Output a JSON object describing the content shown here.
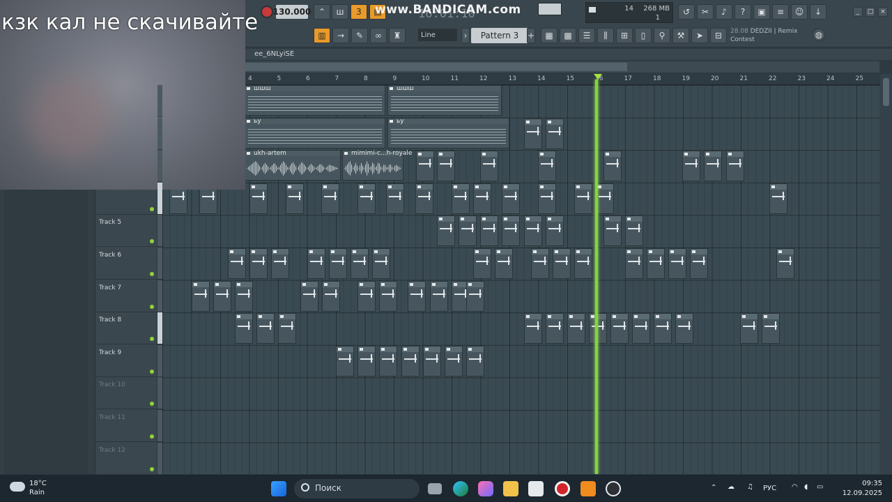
{
  "overlay": {
    "caption": "кзк кал не скачивайте"
  },
  "toolbar": {
    "tempo": "130.000",
    "time": "16:01:10",
    "watermark": "www.BANDICAM.com",
    "cpu_value": "14",
    "ram_value": "268 MB",
    "poly_value": "1",
    "snap_label": "Line",
    "pattern_label": "Pattern 3",
    "news_date": "28.08",
    "news_text": "DEDZII | Remix Contest"
  },
  "playlist": {
    "title": "ee_6NLyiSE",
    "ruler_ticks": [
      "4",
      "5",
      "6",
      "7",
      "8",
      "9",
      "10",
      "11",
      "12",
      "13",
      "14",
      "15",
      "16",
      "17",
      "18",
      "19",
      "20",
      "21",
      "22",
      "23",
      "24",
      "25"
    ],
    "tracks": [
      {
        "name": "",
        "dim": false
      },
      {
        "name": "",
        "dim": false
      },
      {
        "name": "",
        "dim": false
      },
      {
        "name": "",
        "dim": false
      },
      {
        "name": "Track 5",
        "dim": false
      },
      {
        "name": "Track 6",
        "dim": false
      },
      {
        "name": "Track 7",
        "dim": false
      },
      {
        "name": "Track 8",
        "dim": false
      },
      {
        "name": "Track 9",
        "dim": false
      },
      {
        "name": "Track 10",
        "dim": true
      },
      {
        "name": "Track 11",
        "dim": true
      },
      {
        "name": "Track 12",
        "dim": true
      }
    ],
    "named_clips": {
      "c1": "шшш",
      "c2": "шшш",
      "c3": "ьу",
      "c4": "ьу",
      "c5": "ukh-artem",
      "c6": "mimimi-c...h-royale"
    }
  },
  "taskbar": {
    "weather_temp": "18°C",
    "weather_desc": "Rain",
    "search_label": "Поиск",
    "lang": "РУС",
    "time": "09:35",
    "date": "12.09.2025"
  },
  "colors": {
    "playhead": "#7fd838",
    "accent": "#e89a2a",
    "background": "#2e3a42"
  }
}
